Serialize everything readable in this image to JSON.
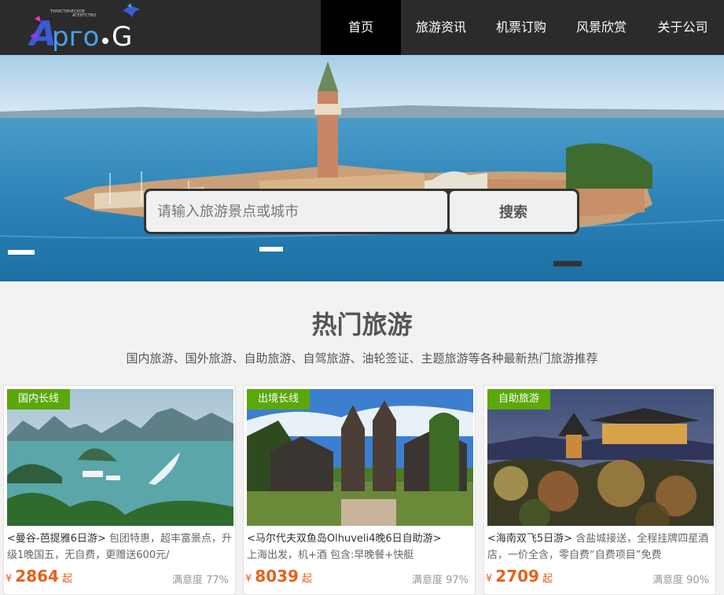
{
  "header": {
    "logo_alt": "Арго.G",
    "nav": [
      {
        "label": "首页",
        "active": true
      },
      {
        "label": "旅游资讯"
      },
      {
        "label": "机票订购"
      },
      {
        "label": "风景欣赏"
      },
      {
        "label": "关于公司"
      }
    ]
  },
  "search": {
    "placeholder": "请输入旅游景点或城市",
    "button_label": "搜索"
  },
  "section": {
    "title": "热门旅游",
    "subtitle": "国内旅游、国外旅游、自助旅游、自驾旅游、油轮签证、主题旅游等各种最新热门旅游推荐"
  },
  "cards": [
    {
      "tag": "国内长线",
      "name": "<曼谷-芭提雅6日游>",
      "desc": "包团特惠，超丰富景点，升级1晚国五，无自费，更赠送600元/",
      "currency": "¥",
      "price": "2864",
      "unit": "起",
      "rating": "满意度 77%"
    },
    {
      "tag": "出境长线",
      "name": "<马尔代夫双鱼岛Olhuveli4晚6日自助游>",
      "desc": "上海出发，机+酒 包含:早晚餐+快艇",
      "currency": "¥",
      "price": "8039",
      "unit": "起",
      "rating": "满意度 97%"
    },
    {
      "tag": "自助旅游",
      "name": "<海南双飞5日游>",
      "desc": "含盐城接送，全程挂牌四星酒店，一价全含，零自费“自费项目”免费",
      "currency": "¥",
      "price": "2709",
      "unit": "起",
      "rating": "满意度 90%"
    }
  ],
  "colors": {
    "header_bg": "#2b2b2b",
    "nav_active_bg": "#000000",
    "tag_bg": "#5aa80a",
    "price": "#e8611a"
  }
}
